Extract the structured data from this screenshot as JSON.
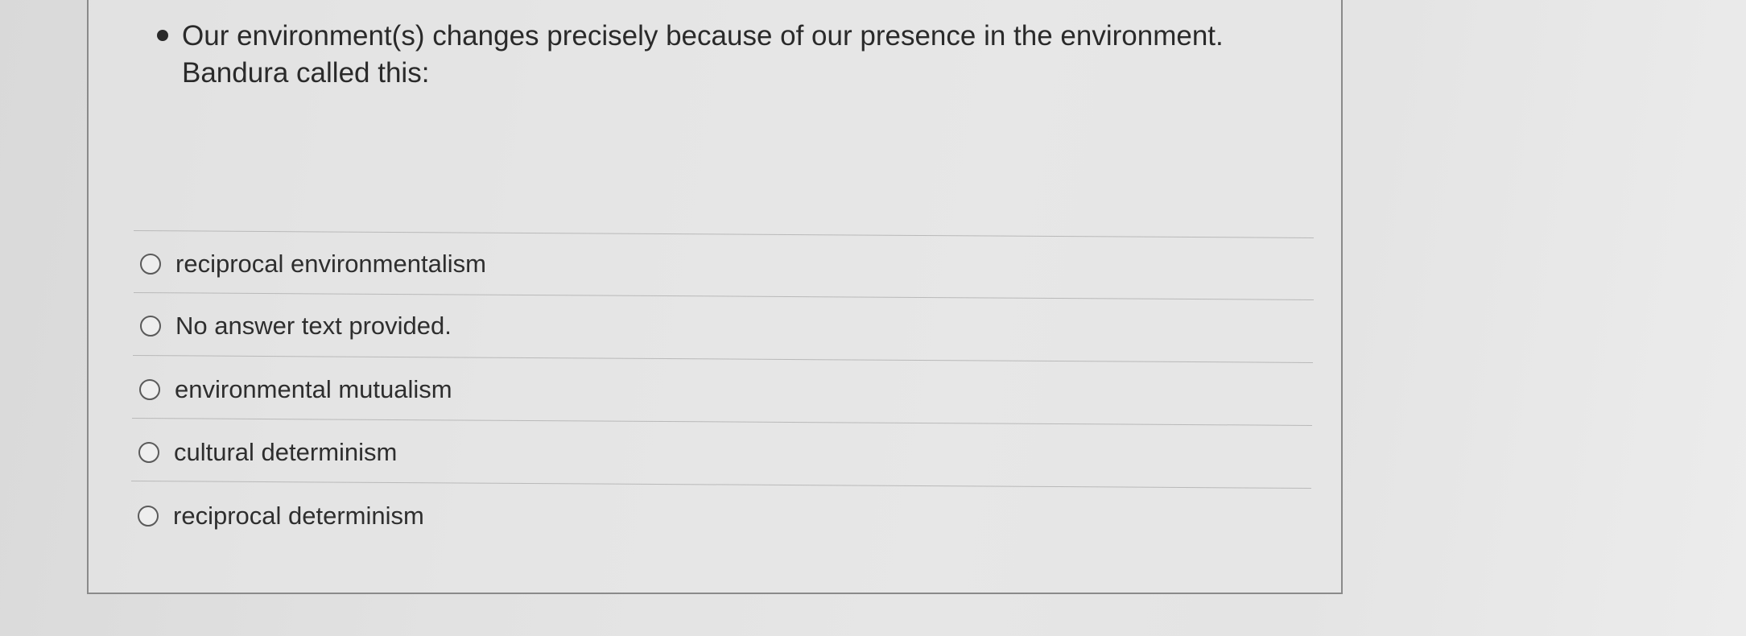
{
  "question": {
    "line1": "Our environment(s) changes precisely because of our presence in the environment.",
    "line2": "Bandura called this:"
  },
  "options": [
    {
      "label": "reciprocal environmentalism",
      "selected": false
    },
    {
      "label": "No answer text provided.",
      "selected": false
    },
    {
      "label": "environmental mutualism",
      "selected": false
    },
    {
      "label": "cultural determinism",
      "selected": false
    },
    {
      "label": "reciprocal determinism",
      "selected": false
    }
  ]
}
